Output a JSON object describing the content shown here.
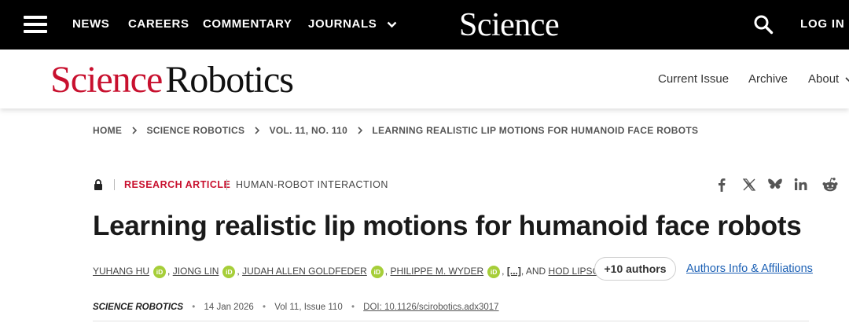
{
  "topbar": {
    "nav": [
      "NEWS",
      "CAREERS",
      "COMMENTARY",
      "JOURNALS"
    ],
    "logo": "Science",
    "login": "LOG IN"
  },
  "journal_header": {
    "logo_part1": "Science",
    "logo_part2": "Robotics",
    "nav": [
      "Current Issue",
      "Archive",
      "About"
    ]
  },
  "breadcrumb": [
    "HOME",
    "SCIENCE ROBOTICS",
    "VOL. 11, NO. 110",
    "LEARNING REALISTIC LIP MOTIONS FOR HUMANOID FACE ROBOTS"
  ],
  "article": {
    "type": "RESEARCH ARTICLE",
    "topic": "HUMAN-ROBOT INTERACTION",
    "title": "Learning realistic lip motions for humanoid face robots",
    "authors": [
      "YUHANG HU",
      "JIONG LIN",
      "JUDAH ALLEN GOLDFEDER",
      "PHILIPPE M. WYDER",
      "HOD LIPSON"
    ],
    "ellipsis": "[...]",
    "and_text": ", AND",
    "comma": ",",
    "orcid_label": "iD",
    "more_authors": "+10 authors",
    "affiliations_link": "Authors Info & Affiliations"
  },
  "citation": {
    "journal": "SCIENCE ROBOTICS",
    "date": "14 Jan 2026",
    "volume": "Vol 11, Issue 110",
    "doi": "DOI: 10.1126/scirobotics.adx3017",
    "separator": "•"
  },
  "icons": {
    "share": [
      "facebook-icon",
      "x-icon",
      "bluesky-icon",
      "linkedin-icon",
      "reddit-icon"
    ]
  },
  "colors": {
    "brand_red": "#c8102e",
    "topbar_bg": "#000000",
    "orcid_green": "#a6ce39",
    "link_blue": "#1a5fb4"
  }
}
